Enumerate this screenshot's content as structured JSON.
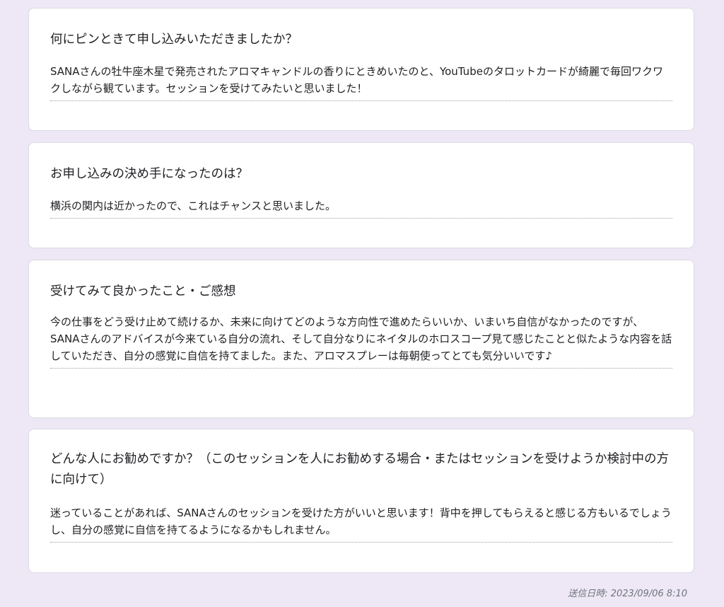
{
  "responses": [
    {
      "question": "何にピンときて申し込みいただきましたか？",
      "answer": "SANAさんの牡牛座木星で発売されたアロマキャンドルの香りにときめいたのと、YouTubeのタロットカードが綺麗で毎回ワクワクしながら観ています。セッションを受けてみたいと思いました！"
    },
    {
      "question": "お申し込みの決め手になったのは？",
      "answer": "横浜の関内は近かったので、これはチャンスと思いました。"
    },
    {
      "question": "受けてみて良かったこと・ご感想",
      "answer": "今の仕事をどう受け止めて続けるか、未来に向けてどのような方向性で進めたらいいか、いまいち自信がなかったのですが、SANAさんのアドバイスが今来ている自分の流れ、そして自分なりにネイタルのホロスコープ見て感じたことと似たような内容を話していただき、自分の感覚に自信を持てました。また、アロマスプレーは毎朝使ってとても気分いいです♪"
    },
    {
      "question": "どんな人にお勧めですか？（このセッションを人にお勧めする場合・またはセッションを受けようか検討中の方に向けて）",
      "answer": "迷っていることがあれば、SANAさんのセッションを受けた方がいいと思います！背中を押してもらえると感じる方もいるでしょうし、自分の感覚に自信を持てるようになるかもしれません。"
    }
  ],
  "footer": {
    "submitted_at": "送信日時: 2023/09/06 8:10"
  },
  "colors": {
    "background": "#ede7f6",
    "card": "#ffffff",
    "text": "#202124",
    "muted": "#70757a"
  }
}
